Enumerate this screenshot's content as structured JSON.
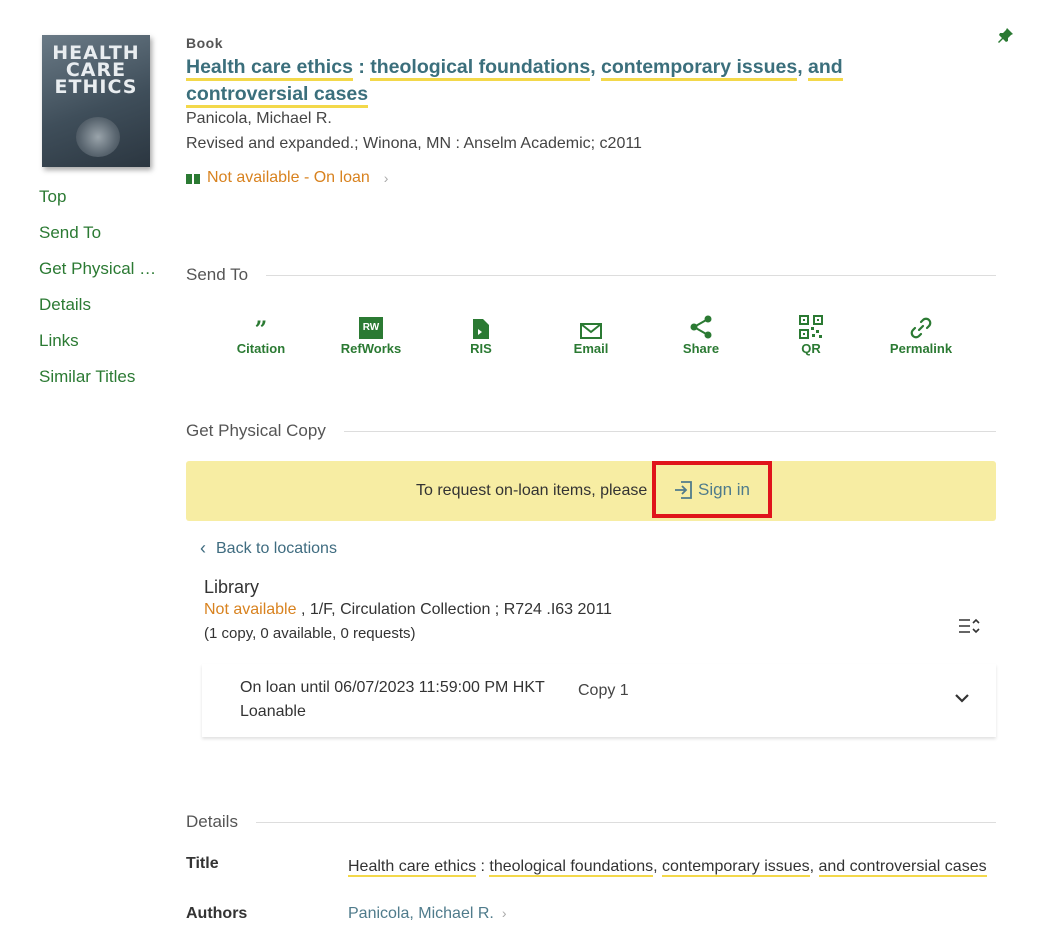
{
  "record": {
    "type": "Book",
    "title_parts": [
      "Health care ethics",
      " : ",
      "theological foundations",
      ", ",
      "contemporary issues",
      ", ",
      "and",
      " ",
      "controversial cases"
    ],
    "author": "Panicola, Michael R.",
    "publication": "Revised and expanded.; Winona, MN : Anselm Academic; c2011",
    "availability": "Not available - On loan",
    "cover_text": "HEALTH\nCARE\nETHICS"
  },
  "nav": [
    "Top",
    "Send To",
    "Get Physical Copy",
    "Details",
    "Links",
    "Similar Titles"
  ],
  "send_to": {
    "heading": "Send To",
    "actions": [
      {
        "label": "Citation",
        "icon": "quote-icon"
      },
      {
        "label": "RefWorks",
        "icon": "refworks-icon",
        "badge": "RW"
      },
      {
        "label": "RIS",
        "icon": "ris-file-icon"
      },
      {
        "label": "Email",
        "icon": "email-icon"
      },
      {
        "label": "Share",
        "icon": "share-icon"
      },
      {
        "label": "QR",
        "icon": "qr-code-icon"
      },
      {
        "label": "Permalink",
        "icon": "link-icon"
      }
    ]
  },
  "physical": {
    "heading": "Get Physical Copy",
    "banner_text": "To request on-loan items, please",
    "sign_in": "Sign in",
    "back": "Back to locations",
    "library": "Library",
    "status": "Not available",
    "location": " , 1/F, Circulation Collection ; R724 .I63 2011",
    "copies": "(1 copy, 0 available, 0 requests)",
    "item": {
      "due": "On loan until 06/07/2023 11:59:00 PM HKT",
      "policy": "Loanable",
      "copy": "Copy 1"
    }
  },
  "details": {
    "heading": "Details",
    "title_label": "Title",
    "title_parts": [
      "Health care ethics",
      " : ",
      "theological foundations",
      ", ",
      "contemporary issues",
      ", ",
      "and controversial cases"
    ],
    "authors_label": "Authors",
    "author": "Panicola, Michael R."
  },
  "colors": {
    "accent_green": "#2b7a33",
    "title_teal": "#3b6f7c",
    "warning_orange": "#d8821f",
    "banner_yellow": "#f7eda3",
    "highlight_red": "#e0141b",
    "underline_yellow": "#f3d84a"
  }
}
